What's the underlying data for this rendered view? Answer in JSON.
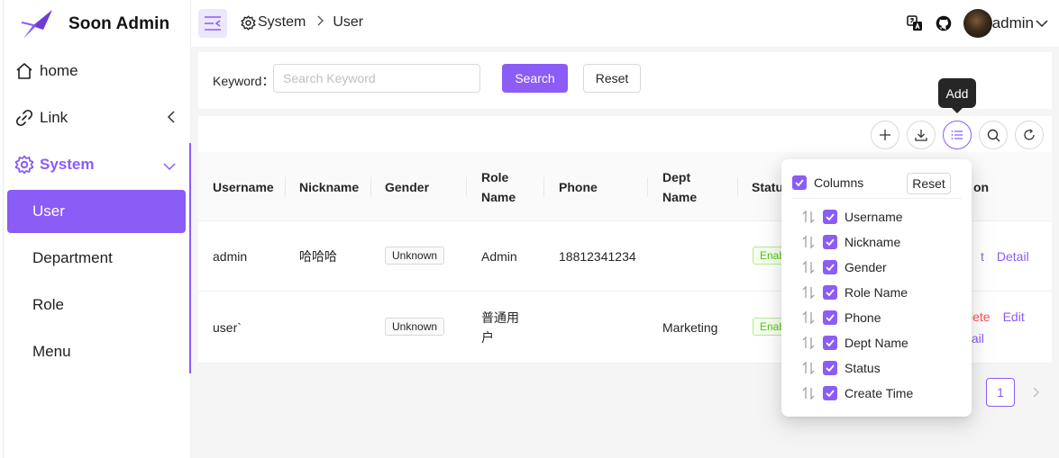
{
  "app": {
    "name": "Soon Admin"
  },
  "sidebar": {
    "items": [
      {
        "label": "home",
        "icon": "home-icon"
      },
      {
        "label": "Link",
        "icon": "link-icon"
      },
      {
        "label": "System",
        "icon": "gear-icon"
      }
    ],
    "submenu": [
      {
        "label": "User",
        "active": true
      },
      {
        "label": "Department"
      },
      {
        "label": "Role"
      },
      {
        "label": "Menu"
      }
    ]
  },
  "header": {
    "breadcrumb": [
      "System",
      "User"
    ],
    "user": "admin"
  },
  "search": {
    "label": "Keyword：",
    "placeholder": "Search Keyword",
    "value": "",
    "search_label": "Search",
    "reset_label": "Reset"
  },
  "table": {
    "columns": [
      "Username",
      "Nickname",
      "Gender",
      "Role Name",
      "Phone",
      "Dept Name",
      "Status",
      "Operation"
    ],
    "column_visible_text": [
      "Username",
      "Nickname",
      "Gender",
      "Role\nName",
      "Phone",
      "Dept\nName",
      "Statu",
      "on"
    ],
    "rows": [
      {
        "username": "admin",
        "nickname": "哈哈哈",
        "gender": "Unknown",
        "role": "Admin",
        "phone": "18812341234",
        "dept": "",
        "status": "Enab",
        "ops": [
          "t",
          "Detail"
        ]
      },
      {
        "username": "user`",
        "nickname": "",
        "gender": "Unknown",
        "role": "普通用户",
        "phone": "",
        "dept": "Marketing",
        "status": "Enab",
        "ops": [
          "lete",
          "Edit",
          "tail"
        ]
      }
    ]
  },
  "pagination": {
    "current": "1"
  },
  "tooltip": {
    "text": "Add"
  },
  "columns_popover": {
    "title": "Columns",
    "reset_label": "Reset",
    "items": [
      "Username",
      "Nickname",
      "Gender",
      "Role Name",
      "Phone",
      "Dept Name",
      "Status",
      "Create Time"
    ]
  },
  "colors": {
    "accent": "#8b5cf6",
    "danger": "#ff4d4f",
    "success": "#52c41a"
  }
}
